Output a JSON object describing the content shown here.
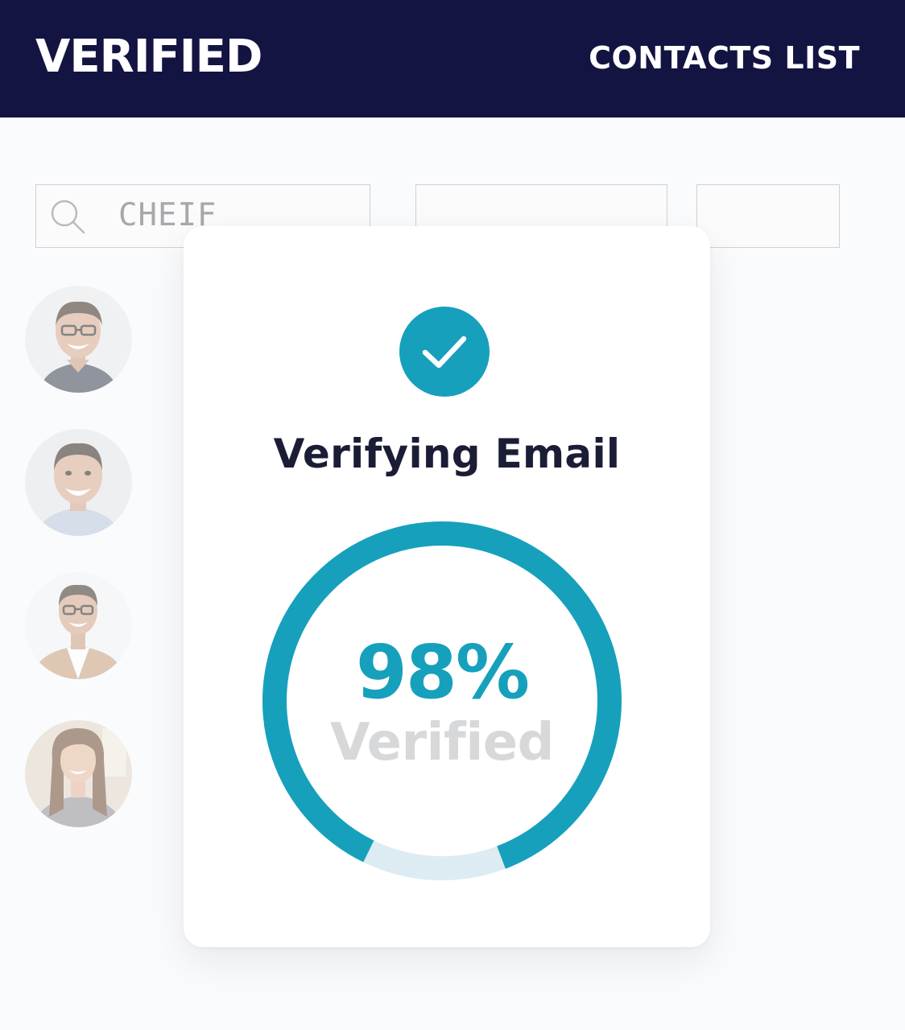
{
  "header": {
    "brand": "VERIFIED",
    "nav_link": "CONTACTS LIST"
  },
  "search": {
    "value": "CHEIF",
    "icon": "search-icon"
  },
  "contacts": [
    {
      "icon": "avatar-man-glasses"
    },
    {
      "icon": "avatar-man-smiling"
    },
    {
      "icon": "avatar-man-glasses-jacket"
    },
    {
      "icon": "avatar-woman-long-hair"
    }
  ],
  "modal": {
    "icon": "check-circle-icon",
    "title": "Verifying Email",
    "progress_percent": 98,
    "percent_text": "98%",
    "status_label": "Verified"
  },
  "colors": {
    "header_bg": "#131442",
    "accent": "#16a0bc",
    "ring_remaining": "#dcecf2",
    "title_text": "#1a1d35",
    "muted_text": "#d7d8da"
  }
}
